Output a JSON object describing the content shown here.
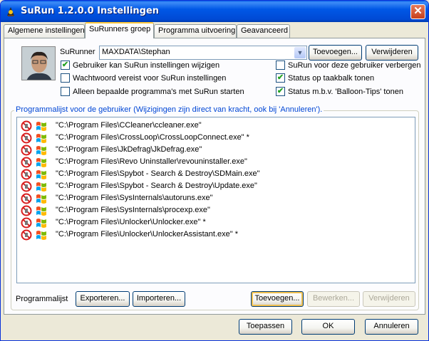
{
  "window": {
    "title": "SuRun 1.2.0.0 Instellingen",
    "close_glyph": "✕"
  },
  "tabs": [
    {
      "label": "Algemene instellingen",
      "active": false
    },
    {
      "label": "SuRunners groep",
      "active": true
    },
    {
      "label": "Programma uitvoering",
      "active": false
    },
    {
      "label": "Geavanceerd",
      "active": false
    }
  ],
  "surunner": {
    "label": "SuRunner",
    "selected": "MAXDATA\\Stephan",
    "add_label": "Toevoegen...",
    "remove_label": "Verwijderen"
  },
  "options": {
    "left": [
      {
        "label": "Gebruiker kan SuRun instellingen wijzigen",
        "checked": true
      },
      {
        "label": "Wachtwoord vereist voor SuRun instellingen",
        "checked": false
      },
      {
        "label": "Alleen bepaalde programma's met SuRun starten",
        "checked": false
      }
    ],
    "right": [
      {
        "label": "SuRun voor deze gebruiker verbergen",
        "checked": false
      },
      {
        "label": "Status op taakbalk tonen",
        "checked": true
      },
      {
        "label": "Status m.b.v. 'Balloon-Tips' tonen",
        "checked": true
      }
    ]
  },
  "programs": {
    "title": "Programmalijst voor de gebruiker (Wijzigingen zijn direct van kracht, ook bij 'Annuleren').",
    "items": [
      "\"C:\\Program Files\\CCleaner\\ccleaner.exe\"",
      "\"C:\\Program Files\\CrossLoop\\CrossLoopConnect.exe\" *",
      "\"C:\\Program Files\\JkDefrag\\JkDefrag.exe\"",
      "\"C:\\Program Files\\Revo Uninstaller\\revouninstaller.exe\"",
      "\"C:\\Program Files\\Spybot - Search & Destroy\\SDMain.exe\"",
      "\"C:\\Program Files\\Spybot - Search & Destroy\\Update.exe\"",
      "\"C:\\Program Files\\SysInternals\\autoruns.exe\"",
      "\"C:\\Program Files\\SysInternals\\procexp.exe\"",
      "\"C:\\Program Files\\Unlocker\\Unlocker.exe\" *",
      "\"C:\\Program Files\\Unlocker\\UnlockerAssistant.exe\" *"
    ],
    "list_label": "Programmalijst",
    "export_label": "Exporteren...",
    "import_label": "Importeren...",
    "add_label": "Toevoegen...",
    "edit_label": "Bewerken...",
    "remove_label": "Verwijderen"
  },
  "footer": {
    "apply_label": "Toepassen",
    "ok_label": "OK",
    "cancel_label": "Annuleren"
  },
  "colors": {
    "titlebar": "#0058e6",
    "face": "#ece9d8",
    "group_title": "#0046d5",
    "no_entry": "#d81e1e"
  },
  "icons": {
    "row_left": "no-entry-icon",
    "row_right": "windows-flag-icon"
  }
}
